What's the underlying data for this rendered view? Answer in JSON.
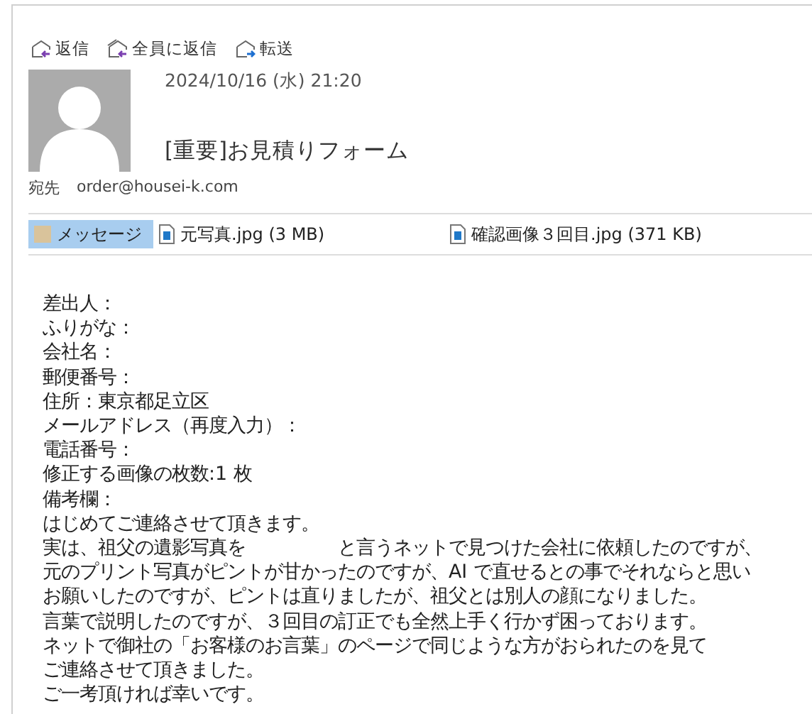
{
  "toolbar": [
    {
      "kind": "reply",
      "label": "返信"
    },
    {
      "kind": "reply_all",
      "label": "全員に返信"
    },
    {
      "kind": "forward",
      "label": "転送"
    }
  ],
  "message": {
    "date": "2024/10/16 (水) 21:20",
    "subject": "[重要]お見積りフォーム",
    "to_label": "宛先",
    "to": "order@housei-k.com"
  },
  "attachments": [
    {
      "kind": "message",
      "label": "メッセージ",
      "selected": true
    },
    {
      "kind": "file",
      "label": "元写真.jpg (3 MB)",
      "selected": false
    },
    {
      "kind": "file",
      "label": "確認画像３回目.jpg (371 KB)",
      "selected": false
    }
  ],
  "body": [
    "差出人：",
    "ふりがな：",
    "会社名：",
    "郵便番号：",
    "住所：東京都足立区",
    "メールアドレス（再度入力）：",
    "電話番号：",
    "修正する画像の枚数:1 枚",
    "備考欄：",
    "はじめてご連絡させて頂きます。",
    "実は、祖父の遺影写真を　　　　　と言うネットで見つけた会社に依頼したのですが、",
    "元のプリント写真がピントが甘かったのですが、AI で直せるとの事でそれならと思い",
    "お願いしたのですが、ピントは直りましたが、祖父とは別人の顔になりました。",
    "言葉で説明したのですが、３回目の訂正でも全然上手く行かず困っております。",
    "ネットで御社の「お客様のお言葉」のページで同じような方がおられたのを見て",
    "ご連絡させて頂きました。",
    "ご一考頂ければ幸いです。"
  ]
}
